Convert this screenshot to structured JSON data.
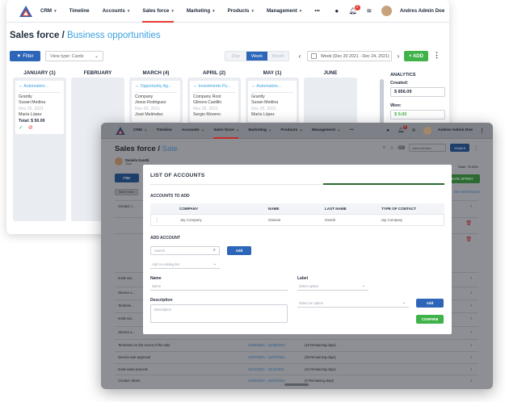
{
  "back": {
    "nav": {
      "items": [
        {
          "label": "CRM",
          "caret": true
        },
        {
          "label": "Timeline",
          "caret": false
        },
        {
          "label": "Accounts",
          "caret": true
        },
        {
          "label": "Sales force",
          "caret": true
        },
        {
          "label": "Marketing",
          "caret": true
        },
        {
          "label": "Products",
          "caret": true
        },
        {
          "label": "Management",
          "caret": true
        },
        {
          "label": "•••",
          "caret": false
        }
      ],
      "active_index": 3,
      "notification_count": "2",
      "username": "Andres Admin Doe"
    },
    "title": {
      "main": "Sales force / ",
      "sub": "Business opportunities"
    },
    "toolbar": {
      "filter_label": "Filter",
      "view_type": "View type: Cards",
      "seg": [
        "Day",
        "Week",
        "Month"
      ],
      "seg_active": 1,
      "week_range": "Week (Dec 20 2021 - Dec 24, 2021)",
      "add_label": "+ ADD"
    },
    "columns": [
      {
        "header": "JANUARY (1)",
        "card": {
          "tag": "⇔ Automation...",
          "company": "Grantly",
          "contact": "Susan Medina",
          "date": "Nov 25, 2021",
          "owner": "María López",
          "total": "Total: $ 50.00",
          "actions": true
        }
      },
      {
        "header": "FEBRUARY",
        "card": null
      },
      {
        "header": "MARCH (4)",
        "card": {
          "tag": "⇔ Opportunity Ag...",
          "company": "Company",
          "contact": "Jesus Rodriguez",
          "date": "Nov 25, 2021",
          "owner": "José Meléndez"
        }
      },
      {
        "header": "APRIL (2)",
        "card": {
          "tag": "⇔ Investments Pu...",
          "company": "Company Root",
          "contact": "Glinora Castillo",
          "date": "Nov 25, 2021",
          "owner": "Sergio Moreno"
        }
      },
      {
        "header": "MAY (1)",
        "card": {
          "tag": "⇔ Automation...",
          "company": "Grantly",
          "contact": "Susan Medina",
          "date": "Nov 25, 2021",
          "owner": "María López"
        }
      },
      {
        "header": "JUNE",
        "card": null
      }
    ],
    "analytics": {
      "title": "ANALYTICS",
      "created_label": "Created:",
      "created_value": "$ 856.09",
      "won_label": "Won:",
      "won_value": "$ 0.00"
    }
  },
  "front": {
    "nav": {
      "items": [
        {
          "label": "CRM",
          "caret": true
        },
        {
          "label": "Timeline",
          "caret": false
        },
        {
          "label": "Accounts",
          "caret": true
        },
        {
          "label": "Sales force",
          "caret": true
        },
        {
          "label": "Marketing",
          "caret": true
        },
        {
          "label": "Products",
          "caret": true
        },
        {
          "label": "Management",
          "caret": true
        },
        {
          "label": "•••",
          "caret": false
        }
      ],
      "active_index": 3,
      "notification_count": "2",
      "username": "Andres Admin Doe"
    },
    "title": {
      "main": "Sales force / ",
      "sub": "Sale"
    },
    "tools": {
      "select": "Administrator",
      "goals_label": "GOALS"
    },
    "person": {
      "name": "Daniela Garetti",
      "goal": "Goal"
    },
    "stats": "State: 75.08%",
    "filter_label": "Filter",
    "create_sprint": "CREATE SPRINT",
    "performance_link": "See performance",
    "chip": "Sales Team",
    "bg_rows": [
      {
        "name": "Contact c...",
        "dates": "",
        "remaining": "",
        "icon": "chev"
      },
      {
        "name": "",
        "dates": "",
        "remaining": "",
        "icon": "trash"
      },
      {
        "name": "",
        "dates": "",
        "remaining": "",
        "icon": "trash"
      },
      {
        "name": "Invite sal...",
        "dates": "",
        "remaining": "",
        "icon": "chev"
      },
      {
        "name": "Service u...",
        "dates": "",
        "remaining": "",
        "icon": "chev"
      },
      {
        "name": "Territorie...",
        "dates": "",
        "remaining": "",
        "icon": "chev"
      },
      {
        "name": "Invite sal...",
        "dates": "",
        "remaining": "",
        "icon": "chev"
      },
      {
        "name": "Service u...",
        "dates": "",
        "remaining": "",
        "icon": "chev"
      },
      {
        "name": "Territories on the recent of the sale",
        "dates": "10/20/2021 - 10/28/2021",
        "remaining": "(10 Remaining days)",
        "icon": "chev"
      },
      {
        "name": "Service sale approval",
        "dates": "10/27/2021 - 10/27/2021",
        "remaining": "(20 Remaining days)",
        "icon": "chev"
      },
      {
        "name": "Invite sales process",
        "dates": "10/11/2021 - 10/11/2021",
        "remaining": "(41 Remaining days)",
        "icon": "chev"
      },
      {
        "name": "Contact clients",
        "dates": "10/10/2021 - 10/12/2021",
        "remaining": "(3 Remaining days)",
        "icon": "chev"
      }
    ],
    "modal": {
      "title": "LIST OF ACCOUNTS",
      "accounts_to_add": "ACCOUNTS TO ADD",
      "columns": [
        "COMPANY",
        "NAME",
        "LAST NAME",
        "TYPE OF CONTACT"
      ],
      "rows": [
        [
          "Jay Company",
          "Daniela",
          "Garetti",
          "Jay Company"
        ]
      ],
      "add_account": "ADD ACCOUNT",
      "search_placeholder": "Search",
      "add_btn": "Add",
      "existing_list_placeholder": "Add to existing list",
      "name_label": "Name",
      "name_placeholder": "Name",
      "label_label": "Label",
      "label_placeholder": "Select option",
      "description_label": "Description",
      "description_placeholder": "Description",
      "option_placeholder": "Select an option",
      "add_btn2": "Add",
      "confirm_btn": "CONFIRM"
    }
  }
}
